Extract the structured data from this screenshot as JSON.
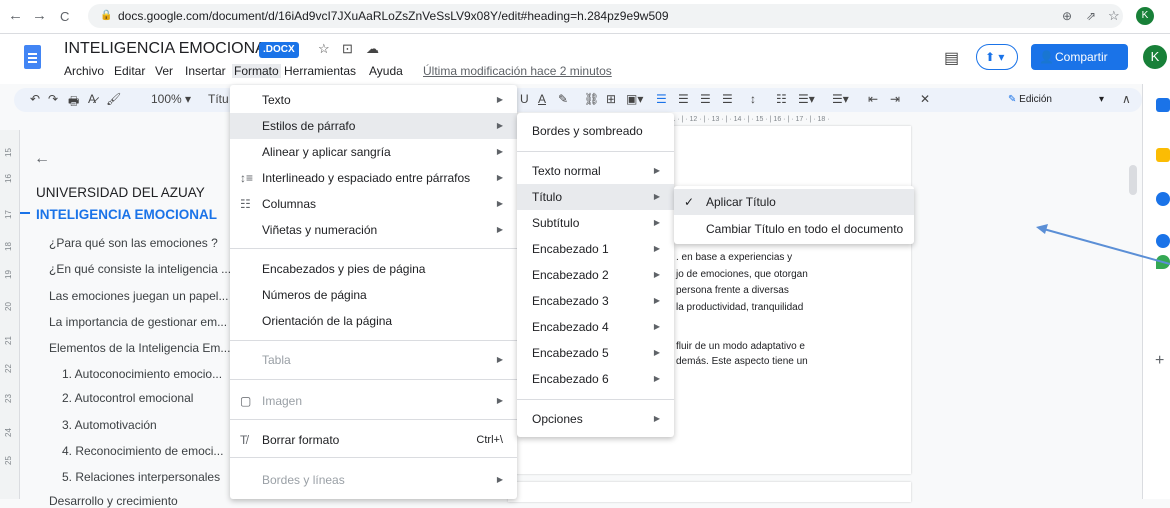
{
  "browser": {
    "url": "docs.google.com/document/d/16iAd9vcI7JXuAaRLoZsZnVeSsLV9x08Y/edit#heading=h.284pz9e9w509",
    "back": "←",
    "forward": "→",
    "reload": "C",
    "avatar": "K"
  },
  "doc": {
    "title": "INTELIGENCIA EMOCIONAL",
    "badge": ".DOCX",
    "last_edit": "Última modificación hace 2 minutos",
    "share": "Compartir",
    "avatar": "K",
    "mode": "Edición"
  },
  "menubar": [
    "Archivo",
    "Editar",
    "Ver",
    "Insertar",
    "Formato",
    "Herramientas",
    "Ayuda"
  ],
  "toolbar": {
    "zoom": "100%",
    "style": "Títu"
  },
  "ruler_left": [
    "15",
    "16",
    "17",
    "18",
    "19",
    "20",
    "21",
    "22",
    "23",
    "24",
    "25"
  ],
  "ruler_top": "11 · | · 12 · | · 13 · | · 14 · | · 15 · | 16 · | · 17 · | · 18 ·",
  "outline": {
    "back": "←",
    "items": [
      {
        "text": "UNIVERSIDAD DEL AZUAY",
        "level": 1
      },
      {
        "text": "INTELIGENCIA EMOCIONAL",
        "level": 1,
        "active": true
      },
      {
        "text": "¿Para qué son las emociones ?",
        "level": 2
      },
      {
        "text": "¿En qué consiste la inteligencia ...",
        "level": 2
      },
      {
        "text": "Las emociones juegan un papel...",
        "level": 2
      },
      {
        "text": "La importancia de gestionar em...",
        "level": 2
      },
      {
        "text": "Elementos de la Inteligencia Em...",
        "level": 2
      },
      {
        "text": "1. Autoconocimiento emocio...",
        "level": 3
      },
      {
        "text": "2. Autocontrol emocional",
        "level": 3
      },
      {
        "text": "3. Automotivación",
        "level": 3
      },
      {
        "text": "4. Reconocimiento de emoci...",
        "level": 3
      },
      {
        "text": "5. Relaciones interpersonales",
        "level": 3
      },
      {
        "text": "Desarrollo y crecimiento",
        "level": 2
      }
    ]
  },
  "doctext": [
    ". en base a experiencias y",
    "jo de emociones, que otorgan",
    "persona frente a diversas",
    "la productividad, tranquilidad",
    "fluir de un modo adaptativo e",
    "demás. Este aspecto tiene un"
  ],
  "format_menu": [
    {
      "label": "Texto",
      "arrow": true
    },
    {
      "label": "Estilos de párrafo",
      "arrow": true,
      "hl": true
    },
    {
      "label": "Alinear y aplicar sangría",
      "arrow": true
    },
    {
      "label": "Interlineado y espaciado entre párrafos",
      "arrow": true,
      "icon": "↕≡"
    },
    {
      "label": "Columnas",
      "arrow": true,
      "icon": "☷"
    },
    {
      "label": "Viñetas y numeración",
      "arrow": true
    },
    {
      "label": "Encabezados y pies de página"
    },
    {
      "label": "Números de página"
    },
    {
      "label": "Orientación de la página"
    },
    {
      "label": "Tabla",
      "arrow": true,
      "disabled": true
    },
    {
      "label": "Imagen",
      "arrow": true,
      "disabled": true,
      "icon": "▢"
    },
    {
      "label": "Borrar formato",
      "shortcut": "Ctrl+\\",
      "icon": "T̸"
    },
    {
      "label": "Bordes y líneas",
      "arrow": true,
      "disabled": true
    }
  ],
  "paragraph_menu": [
    {
      "label": "Bordes y sombreado"
    },
    {
      "label": "Texto normal",
      "arrow": true
    },
    {
      "label": "Título",
      "arrow": true,
      "hl": true
    },
    {
      "label": "Subtítulo",
      "arrow": true
    },
    {
      "label": "Encabezado 1",
      "arrow": true
    },
    {
      "label": "Encabezado 2",
      "arrow": true
    },
    {
      "label": "Encabezado 3",
      "arrow": true
    },
    {
      "label": "Encabezado 4",
      "arrow": true
    },
    {
      "label": "Encabezado 5",
      "arrow": true
    },
    {
      "label": "Encabezado 6",
      "arrow": true
    },
    {
      "label": "Opciones",
      "arrow": true
    }
  ],
  "title_menu": [
    {
      "label": "Aplicar Título",
      "check": "✓",
      "hl": true
    },
    {
      "label": "Cambiar Título en todo el documento"
    }
  ],
  "colors": {
    "accent": "#1a73e8",
    "arrow": "#5b8fd6"
  }
}
